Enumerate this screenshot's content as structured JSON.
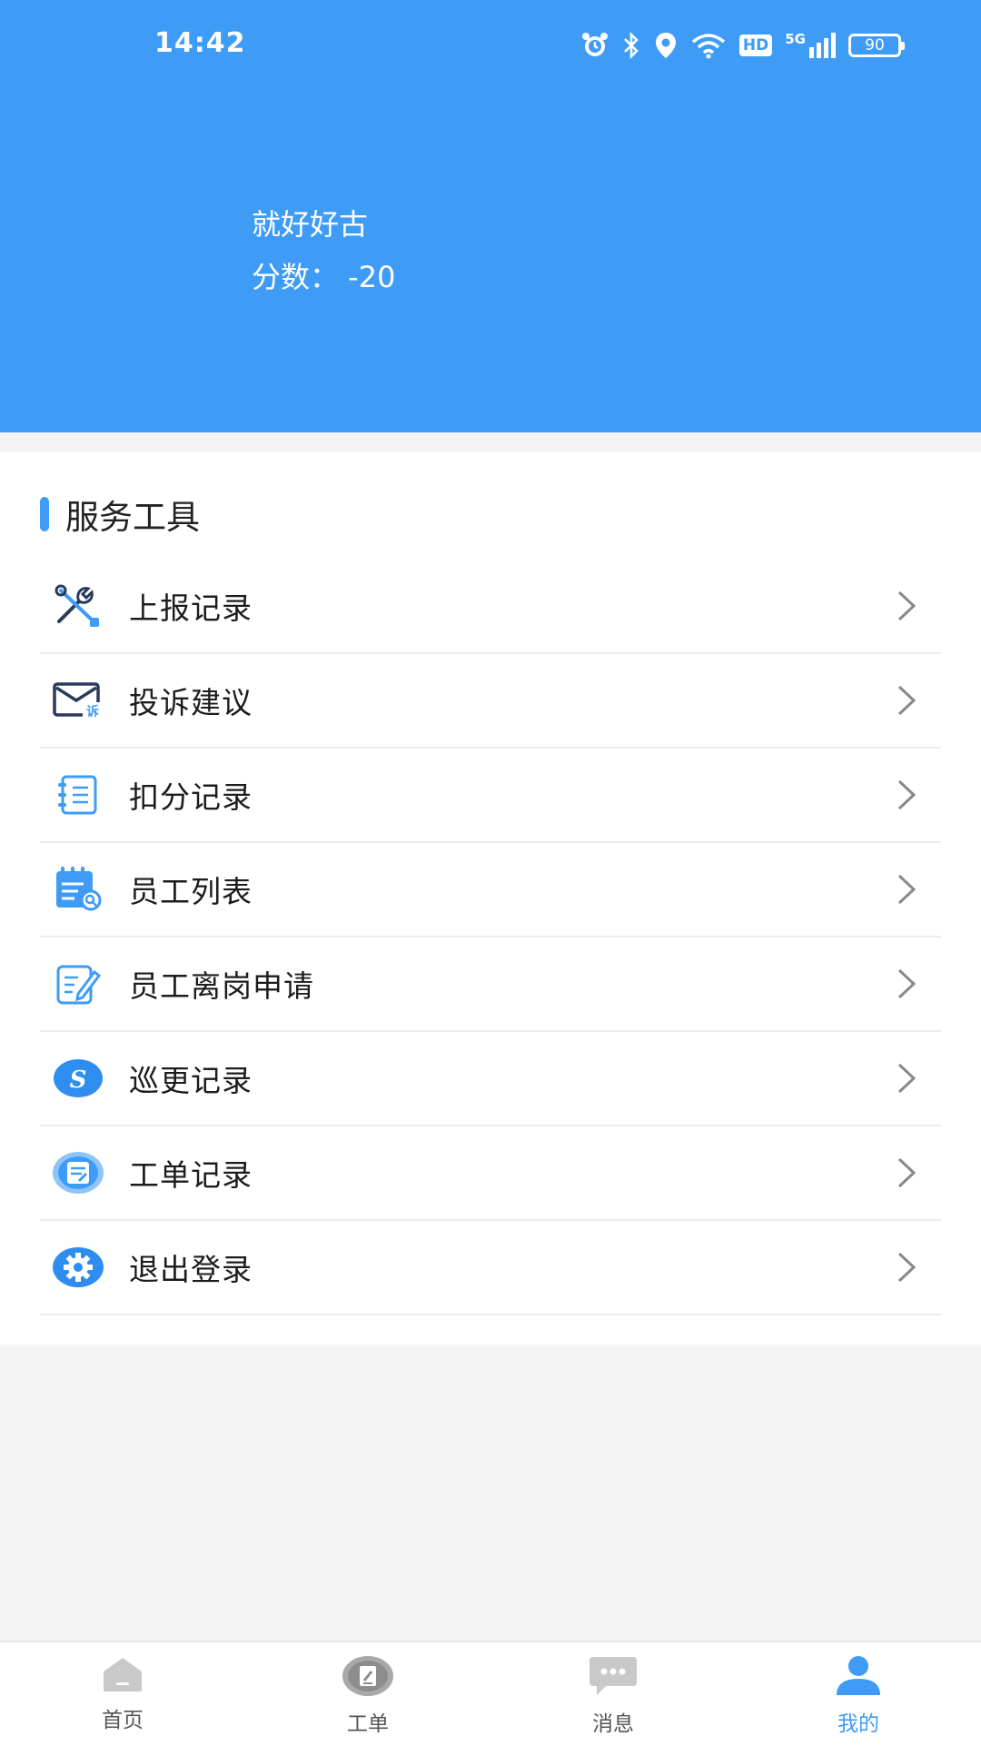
{
  "status": {
    "time": "14:42",
    "hd": "HD",
    "network": "5G",
    "battery": "90"
  },
  "user": {
    "name": "就好好古",
    "score": "分数： -20"
  },
  "section": {
    "title": "服务工具"
  },
  "menu": [
    {
      "label": "上报记录",
      "icon": "wrench-icon"
    },
    {
      "label": "投诉建议",
      "icon": "envelope-complaint-icon"
    },
    {
      "label": "扣分记录",
      "icon": "notebook-icon"
    },
    {
      "label": "员工列表",
      "icon": "calendar-search-icon"
    },
    {
      "label": "员工离岗申请",
      "icon": "edit-form-icon"
    },
    {
      "label": "巡更记录",
      "icon": "patrol-s-icon"
    },
    {
      "label": "工单记录",
      "icon": "workorder-icon"
    },
    {
      "label": "退出登录",
      "icon": "gear-icon"
    }
  ],
  "tabs": [
    {
      "label": "首页",
      "icon": "home-icon"
    },
    {
      "label": "工单",
      "icon": "workorder-edit-icon"
    },
    {
      "label": "消息",
      "icon": "message-icon"
    },
    {
      "label": "我的",
      "icon": "user-icon"
    }
  ],
  "colors": {
    "primary": "#3e9bf6",
    "background": "#f4f4f4",
    "inactive": "#c2c2c2"
  }
}
